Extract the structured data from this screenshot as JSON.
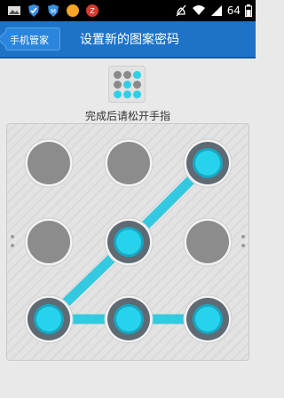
{
  "status_bar": {
    "battery_level": "64",
    "notification_icons": [
      "image-icon",
      "shield-icon",
      "m-shield-icon",
      "orange-circle-icon",
      "z-app-icon"
    ],
    "right_icons": [
      "mute-icon",
      "wifi-icon",
      "signal-icon",
      "battery-icon"
    ]
  },
  "header": {
    "back_label": "手机管家",
    "title": "设置新的图案密码",
    "color": "#1e73c8"
  },
  "pattern_preview": {
    "selected_dots": [
      2,
      4,
      6,
      7,
      8
    ],
    "active_color": "#2fd0e6",
    "inactive_color": "#8a8a8a"
  },
  "hint": "完成后请松开手指",
  "pattern_grid": {
    "rows": 3,
    "cols": 3,
    "selected_path": [
      2,
      4,
      6,
      7,
      8
    ],
    "active_color": "#27d3ec",
    "line_color": "#33c9e0",
    "inactive_color": "#8c8c8c"
  }
}
